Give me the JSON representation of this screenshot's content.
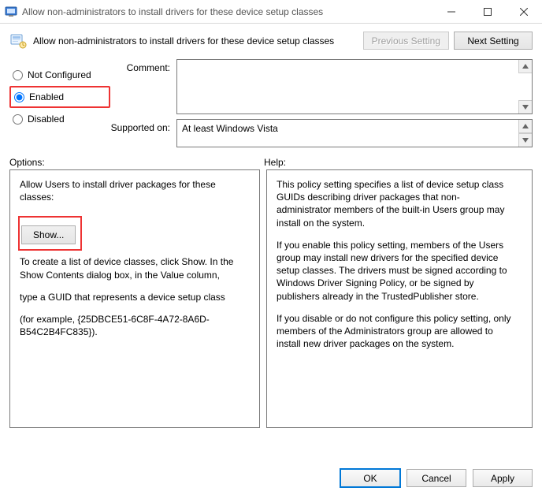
{
  "window": {
    "title": "Allow non-administrators to install drivers for these device setup classes"
  },
  "header": {
    "policy_title": "Allow non-administrators to install drivers for these device setup classes",
    "previous_setting": "Previous Setting",
    "next_setting": "Next Setting"
  },
  "radios": {
    "not_configured": "Not Configured",
    "enabled": "Enabled",
    "disabled": "Disabled",
    "selected": "enabled"
  },
  "fields": {
    "comment_label": "Comment:",
    "comment_value": "",
    "supported_label": "Supported on:",
    "supported_value": "At least Windows Vista"
  },
  "labels": {
    "options": "Options:",
    "help": "Help:"
  },
  "options_pane": {
    "intro": "Allow Users to install driver packages for these classes:",
    "show_button": "Show...",
    "line1": "To create a list of device classes, click Show. In the Show Contents dialog box, in the Value column,",
    "line2": "type a GUID that represents a device setup class",
    "line3": "(for example, {25DBCE51-6C8F-4A72-8A6D-B54C2B4FC835})."
  },
  "help_pane": {
    "p1": "This policy setting specifies a list of device setup class GUIDs describing driver packages that non-administrator members of the built-in Users group may install on the system.",
    "p2": "If you enable this policy setting, members of the Users group may install new drivers for the specified device setup classes. The drivers must be signed according to Windows Driver Signing Policy, or be signed by publishers already in the TrustedPublisher store.",
    "p3": "If you disable or do not configure this policy setting, only members of the Administrators group are allowed to install new driver packages on the system."
  },
  "footer": {
    "ok": "OK",
    "cancel": "Cancel",
    "apply": "Apply"
  }
}
